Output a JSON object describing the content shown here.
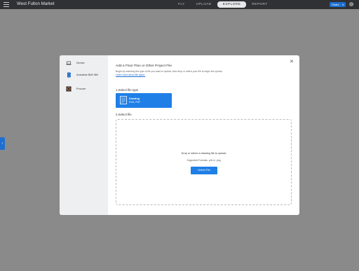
{
  "topbar": {
    "app_title": "West Fulton Market",
    "nav": [
      "FLY",
      "UPLOAD",
      "EXPLORE",
      "REPORT"
    ],
    "active_nav": "EXPLORE",
    "share_label": "Share"
  },
  "modal": {
    "sources": [
      {
        "label": "Device",
        "icon": "laptop-icon"
      },
      {
        "label": "Autodesk BIM 360",
        "icon": "bim360-logo-icon"
      },
      {
        "label": "Procore",
        "icon": "procore-logo-icon"
      }
    ],
    "heading": "Add a Floor Plan or Other Project File",
    "description": "Begin by selecting the type of file you want to upload, then drop or select your file to begin the upload.",
    "learn_more": "Learn more about file types.",
    "step1_label": "1.Select file type",
    "file_type": {
      "name": "Drawing",
      "formats": "PNG, PDF"
    },
    "step2_label": "2.Select file",
    "drop_text": "Drop or select a drawing file to upload",
    "supported_formats": "Supported Formats: .pdf or .png",
    "select_button": "Select File"
  },
  "colors": {
    "accent": "#1f7fe6",
    "topbar": "#2f3135",
    "backdrop": "#8a8a8a"
  }
}
